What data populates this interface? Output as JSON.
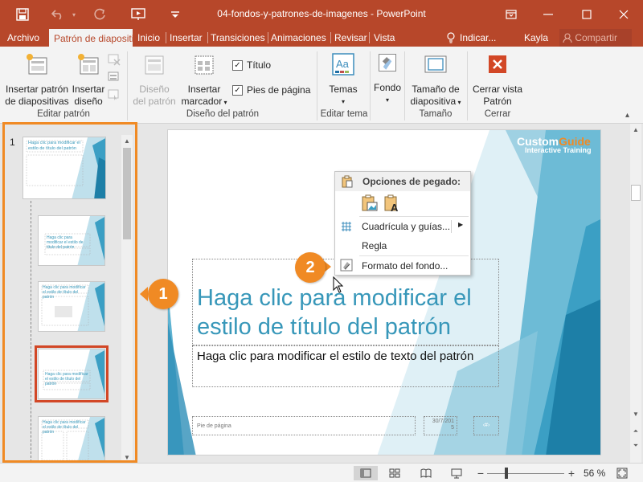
{
  "window": {
    "title": "04-fondos-y-patrones-de-imagenes - PowerPoint",
    "accent": "#b7472a"
  },
  "tabs": [
    {
      "label": "Archivo"
    },
    {
      "label": "Patrón de diapositivas"
    },
    {
      "label": "Inicio"
    },
    {
      "label": "Insertar"
    },
    {
      "label": "Transiciones"
    },
    {
      "label": "Animaciones"
    },
    {
      "label": "Revisar"
    },
    {
      "label": "Vista"
    }
  ],
  "tellme": "Indicar...",
  "user": "Kayla",
  "share": "Compartir",
  "ribbon": {
    "insert_master": [
      "Insertar patrón",
      "de diapositivas"
    ],
    "insert_layout": [
      "Insertar",
      "diseño"
    ],
    "group_edit_master": "Editar patrón",
    "master_layout": [
      "Diseño",
      "del patrón"
    ],
    "insert_placeholder": [
      "Insertar",
      "marcador"
    ],
    "title_checkbox": "Título",
    "footer_checkbox": "Pies de página",
    "group_master_layout": "Diseño del patrón",
    "themes": "Temas",
    "group_edit_theme": "Editar tema",
    "background": "Fondo",
    "slide_size": [
      "Tamaño de",
      "diapositiva"
    ],
    "group_size": "Tamaño",
    "close_master": [
      "Cerrar vista",
      "Patrón"
    ],
    "group_close": "Cerrar"
  },
  "thumbnails": {
    "slide_number": "1",
    "master_title": "Haga clic para modificar el estilo de título del patrón",
    "layout_title": "Haga clic para modificar el estilo de título del patrón"
  },
  "slide": {
    "title": "Haga clic para modificar el estilo de título del patrón",
    "title_lines": [
      "Haga clic para modificar el",
      "estilo de título del patrón"
    ],
    "body": "Haga clic para modificar el estilo de texto del patrón",
    "footer": "Pie de página",
    "date": "30/7/2015",
    "date_lines": [
      "30/7/201",
      "5"
    ],
    "slide_number": "‹#›",
    "logo_main": "CustomGuide",
    "logo_main_a": "Custom",
    "logo_main_b": "Guide",
    "logo_sub": "Interactive Training"
  },
  "context_menu": {
    "header": "Opciones de pegado:",
    "items": [
      {
        "label": "Cuadrícula y guías..."
      },
      {
        "label": "Regla"
      },
      {
        "label": "Formato del fondo..."
      }
    ]
  },
  "callouts": [
    "1",
    "2"
  ],
  "status": {
    "zoom": "56 %"
  }
}
